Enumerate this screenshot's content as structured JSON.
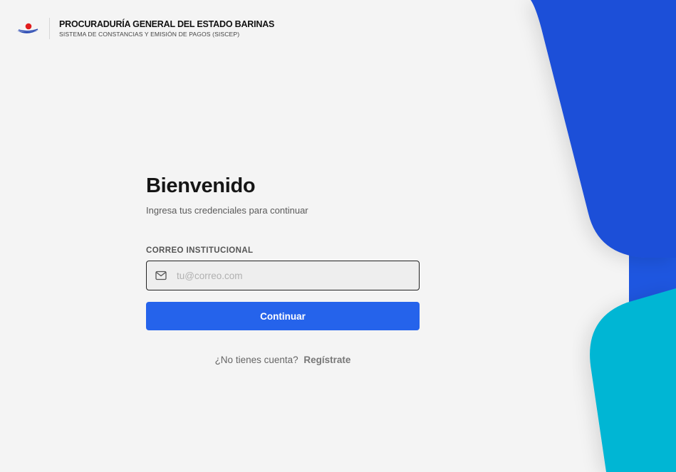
{
  "header": {
    "org_name": "PROCURADURÍA GENERAL DEL ESTADO BARINAS",
    "system_name": "SISTEMA DE CONSTANCIAS Y EMISIÓN DE PAGOS (SISCEP)",
    "logo_icon": "institution-logo-icon"
  },
  "login": {
    "title": "Bienvenido",
    "subtitle": "Ingresa tus credenciales para continuar",
    "email_label": "CORREO INSTITUCIONAL",
    "email_placeholder": "tu@correo.com",
    "email_value": "",
    "email_icon": "mail-icon",
    "continue_label": "Continuar",
    "no_account_text": "¿No tienes cuenta?",
    "register_label": "Regístrate"
  },
  "colors": {
    "background": "#f4f4f4",
    "primary": "#2563eb",
    "decor_blue": "#1f4fd8",
    "decor_cyan": "#06b6d4",
    "logo_red": "#e11d1d",
    "logo_blue": "#1e40af"
  }
}
